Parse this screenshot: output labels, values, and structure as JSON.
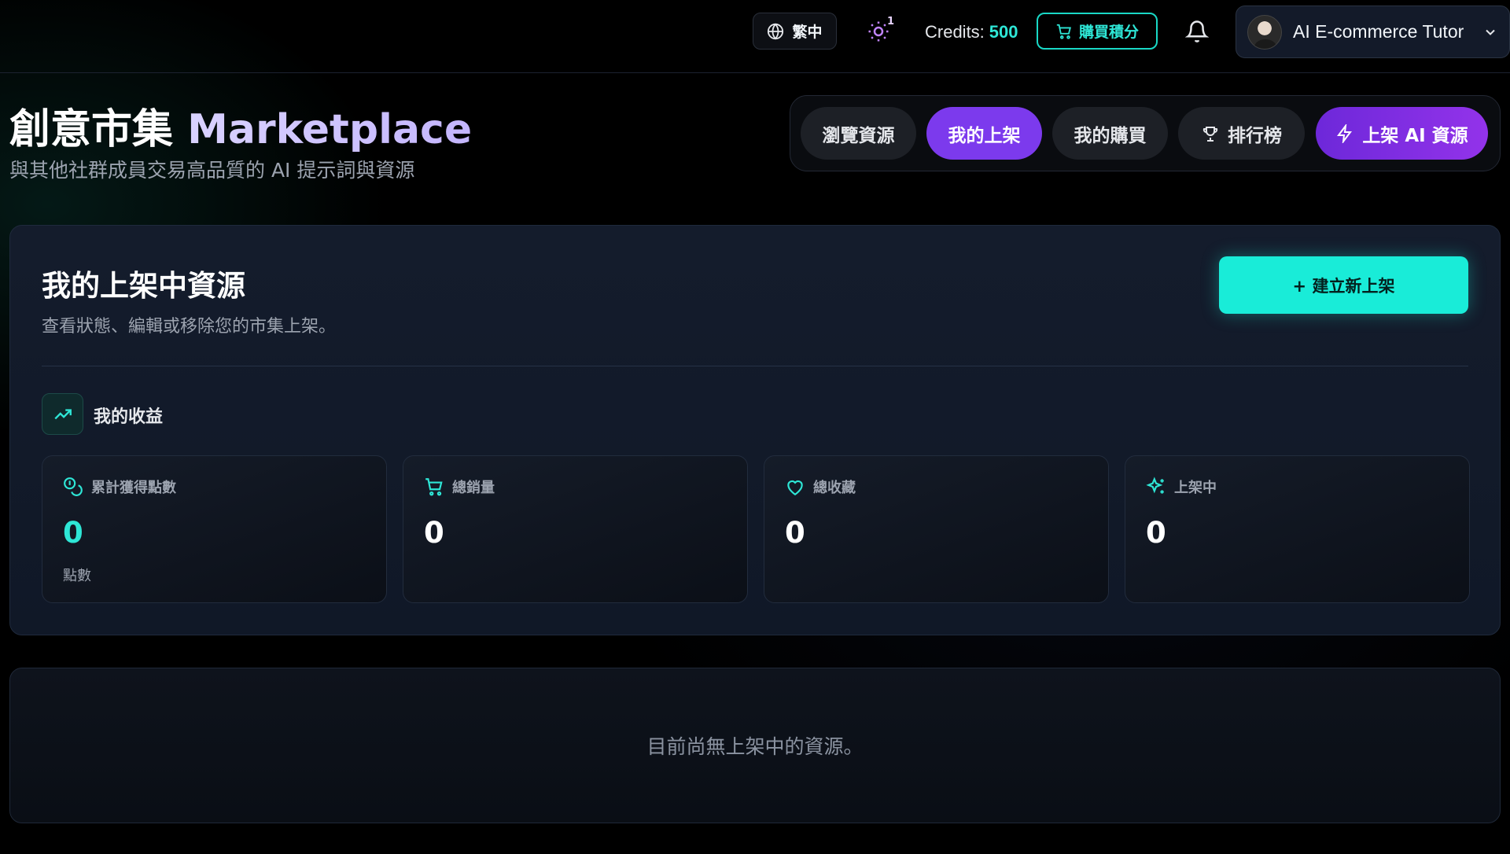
{
  "topbar": {
    "language_label": "繁中",
    "theme_badge": "1",
    "credits_label": "Credits:",
    "credits_value": "500",
    "buy_label": "購買積分",
    "user_name": "AI E-commerce Tutor"
  },
  "header": {
    "title_cn": "創意市集",
    "title_en": "Marketplace",
    "subtitle": "與其他社群成員交易高品質的 AI 提示詞與資源"
  },
  "tabs": [
    {
      "label": "瀏覽資源",
      "icon": ""
    },
    {
      "label": "我的上架",
      "icon": "",
      "active": true
    },
    {
      "label": "我的購買",
      "icon": ""
    },
    {
      "label": "排行榜",
      "icon": "trophy-icon"
    },
    {
      "label": "上架 AI 資源",
      "icon": "lightning-icon"
    }
  ],
  "listings": {
    "title": "我的上架中資源",
    "subtitle": "查看狀態、編輯或移除您的市集上架。",
    "create_label": "+ 建立新上架",
    "earnings_label": "我的收益",
    "stats": [
      {
        "label": "累計獲得點數",
        "value": "0",
        "unit": "點數",
        "icon": "coins-icon"
      },
      {
        "label": "總銷量",
        "value": "0",
        "icon": "cart-icon"
      },
      {
        "label": "總收藏",
        "value": "0",
        "icon": "heart-icon"
      },
      {
        "label": "上架中",
        "value": "0",
        "icon": "sparkles-icon"
      }
    ]
  },
  "empty_state": "目前尚無上架中的資源。",
  "colors": {
    "accent_teal": "#19ecd8",
    "accent_purple": "#7c3aed"
  }
}
